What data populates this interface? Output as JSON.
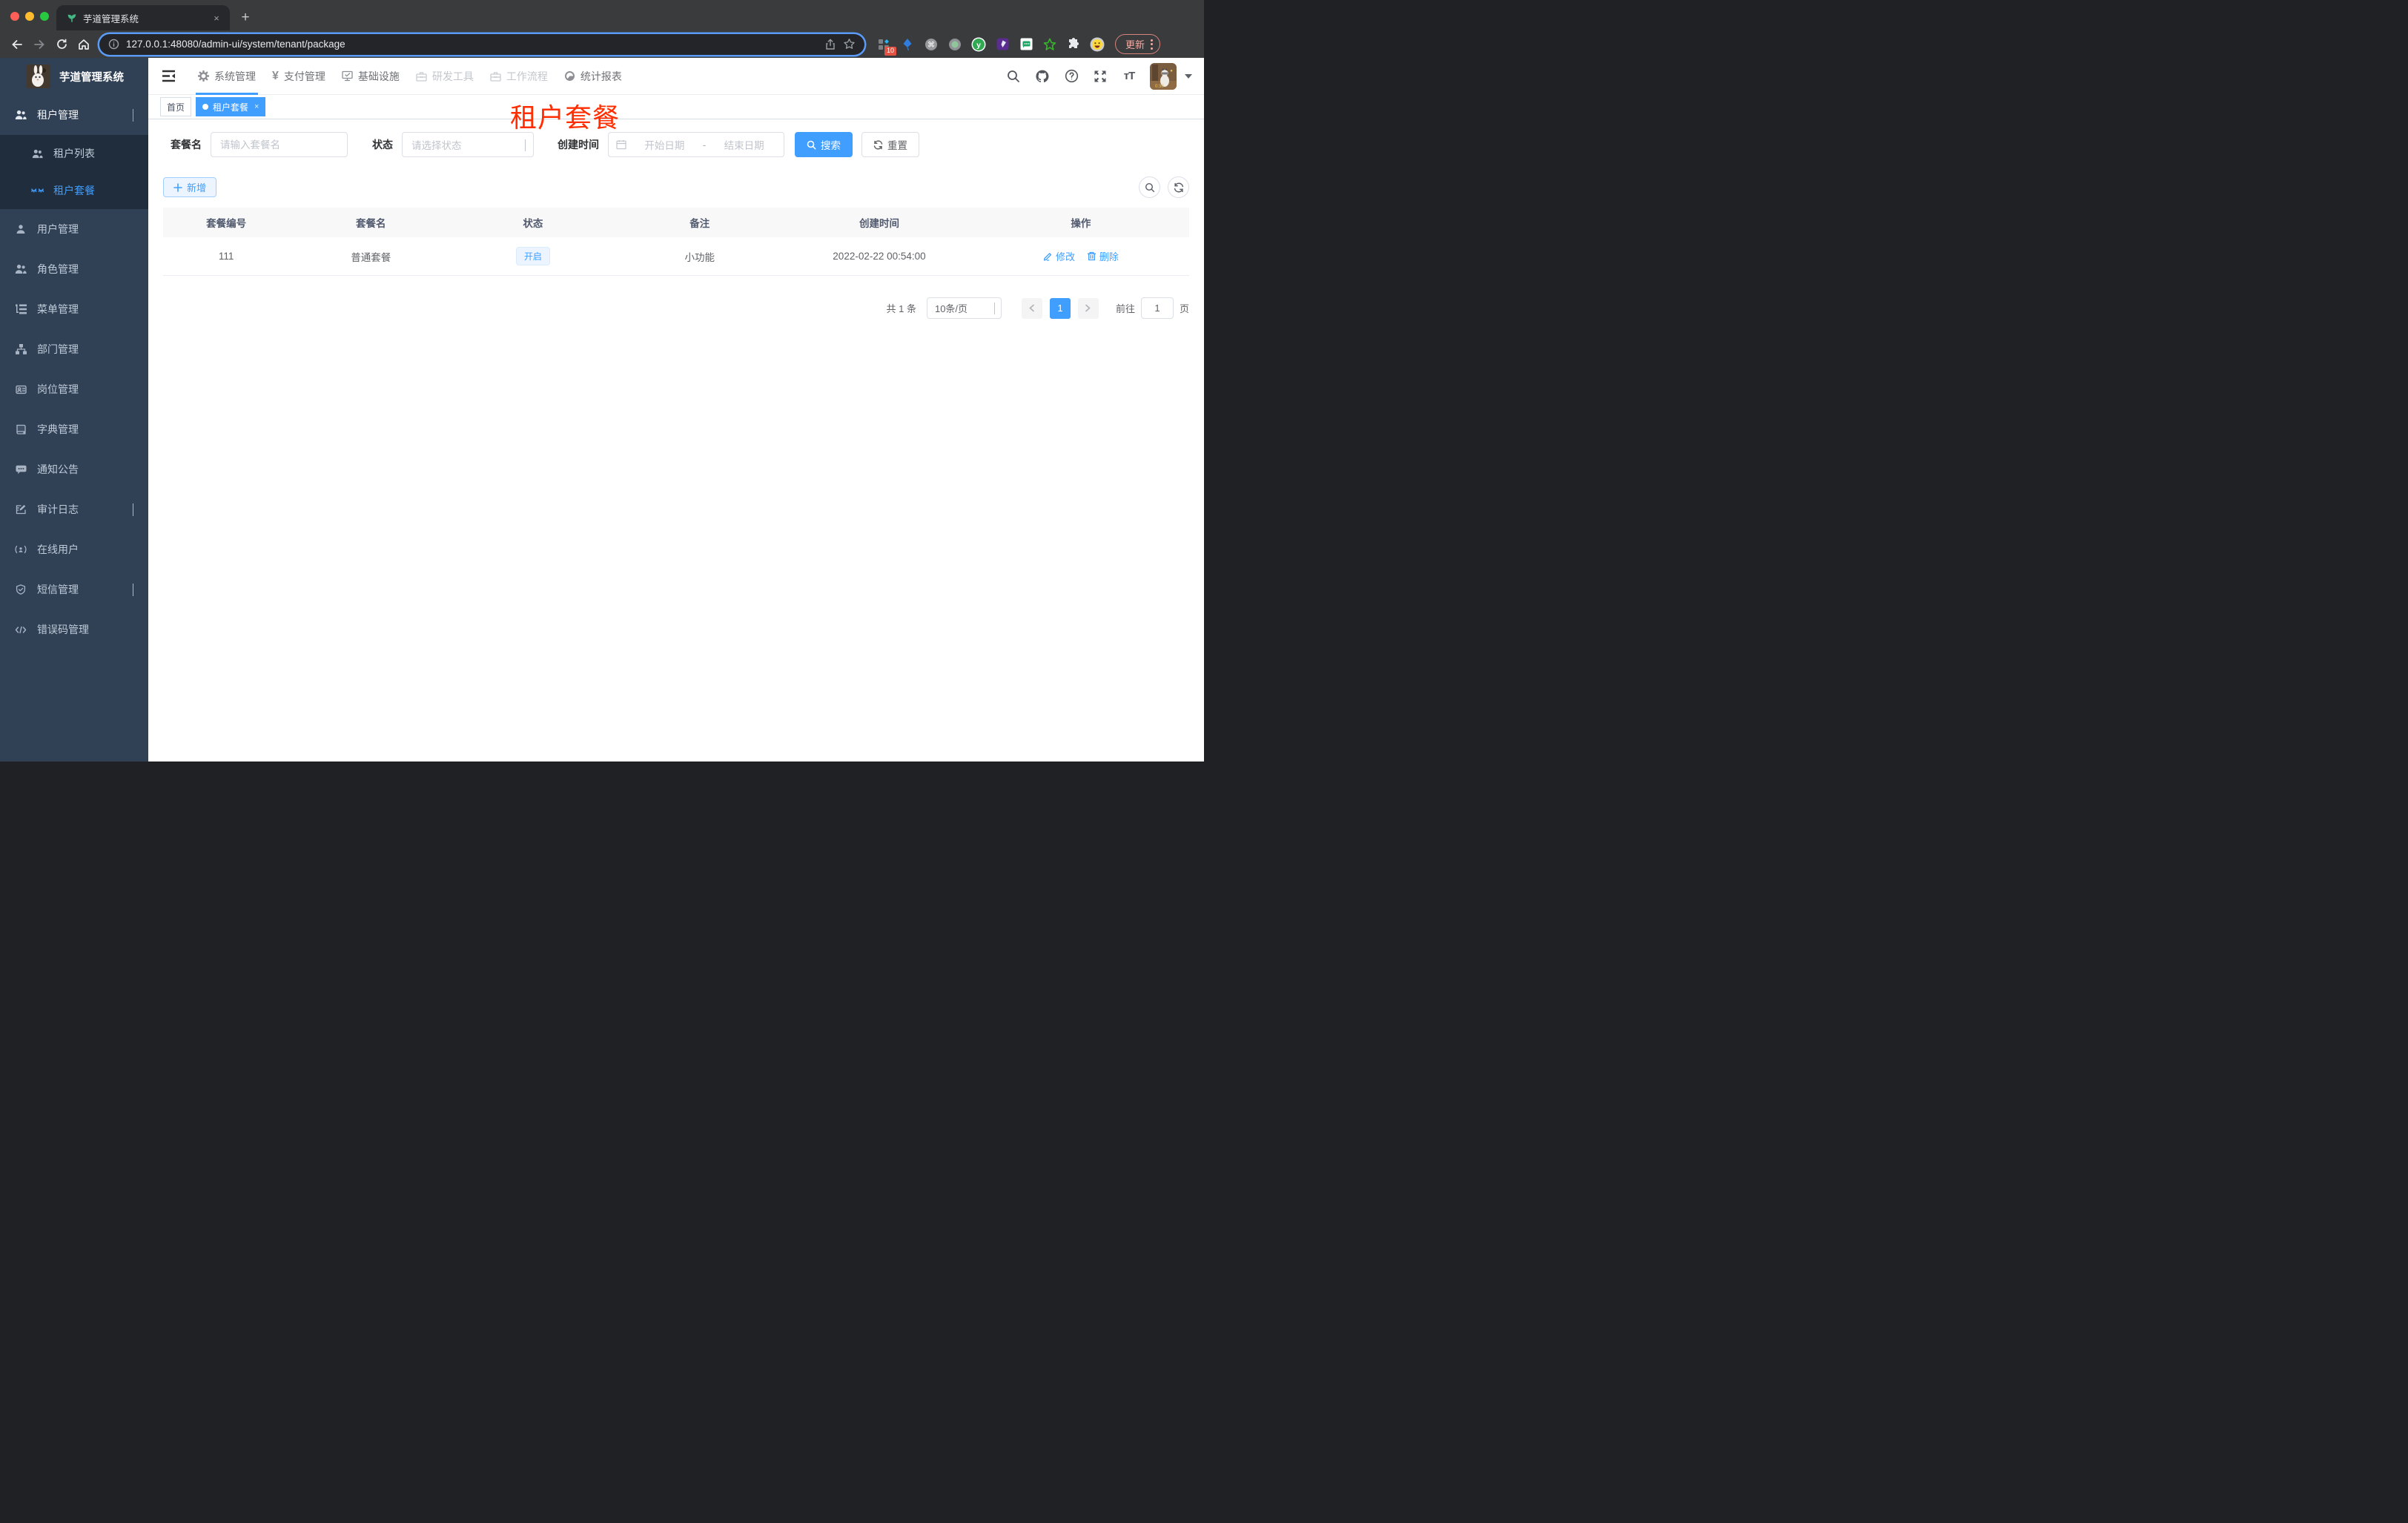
{
  "browser": {
    "tab_title": "芋道管理系统",
    "tab_close": "×",
    "new_tab": "+",
    "url": "127.0.0.1:48080/admin-ui/system/tenant/package",
    "extension_badge": "10",
    "update_label": "更新"
  },
  "app": {
    "logo_title": "芋道管理系统",
    "top_nav": {
      "items": [
        {
          "label": "系统管理",
          "icon": "gear-icon",
          "state": "active"
        },
        {
          "label": "支付管理",
          "icon": "yen-icon",
          "state": "normal"
        },
        {
          "label": "基础设施",
          "icon": "monitor-icon",
          "state": "normal"
        },
        {
          "label": "研发工具",
          "icon": "toolbox-icon",
          "state": "disabled"
        },
        {
          "label": "工作流程",
          "icon": "workflow-icon",
          "state": "disabled"
        },
        {
          "label": "统计报表",
          "icon": "report-icon",
          "state": "normal"
        }
      ]
    },
    "sidebar": {
      "items": [
        {
          "label": "租户管理",
          "type": "group-expanded"
        },
        {
          "label": "租户列表",
          "type": "sub"
        },
        {
          "label": "租户套餐",
          "type": "sub-active"
        },
        {
          "label": "用户管理",
          "type": "item"
        },
        {
          "label": "角色管理",
          "type": "item"
        },
        {
          "label": "菜单管理",
          "type": "item"
        },
        {
          "label": "部门管理",
          "type": "item"
        },
        {
          "label": "岗位管理",
          "type": "item"
        },
        {
          "label": "字典管理",
          "type": "item"
        },
        {
          "label": "通知公告",
          "type": "item"
        },
        {
          "label": "审计日志",
          "type": "group-collapsed"
        },
        {
          "label": "在线用户",
          "type": "item"
        },
        {
          "label": "短信管理",
          "type": "group-collapsed"
        },
        {
          "label": "错误码管理",
          "type": "item"
        }
      ]
    },
    "tags": {
      "items": [
        {
          "label": "首页",
          "active": false
        },
        {
          "label": "租户套餐",
          "active": true,
          "close": "×"
        }
      ]
    },
    "annotation": "租户套餐",
    "filters": {
      "name_label": "套餐名",
      "name_placeholder": "请输入套餐名",
      "status_label": "状态",
      "status_placeholder": "请选择状态",
      "time_label": "创建时间",
      "start_placeholder": "开始日期",
      "range_separator": "-",
      "end_placeholder": "结束日期",
      "search_label": "搜索",
      "reset_label": "重置"
    },
    "toolbar": {
      "add_label": "新增"
    },
    "table": {
      "columns": [
        "套餐编号",
        "套餐名",
        "状态",
        "备注",
        "创建时间",
        "操作"
      ],
      "rows": [
        {
          "id": "111",
          "name": "普通套餐",
          "status": "开启",
          "remark": "小功能",
          "created": "2022-02-22 00:54:00",
          "edit_label": "修改",
          "delete_label": "删除"
        }
      ]
    },
    "pagination": {
      "total": "共 1 条",
      "page_size": "10条/页",
      "current_page": "1",
      "goto_prefix": "前往",
      "goto_value": "1",
      "goto_suffix": "页"
    }
  },
  "colors": {
    "accent": "#409eff",
    "sidebar_bg": "#304156",
    "submenu_bg": "#1f2d3d",
    "annotation_red": "#ff2d00",
    "status_tag_bg": "#ecf5ff",
    "traffic_close": "#ff5f57",
    "traffic_min": "#febc2e",
    "traffic_zoom": "#28c840"
  }
}
